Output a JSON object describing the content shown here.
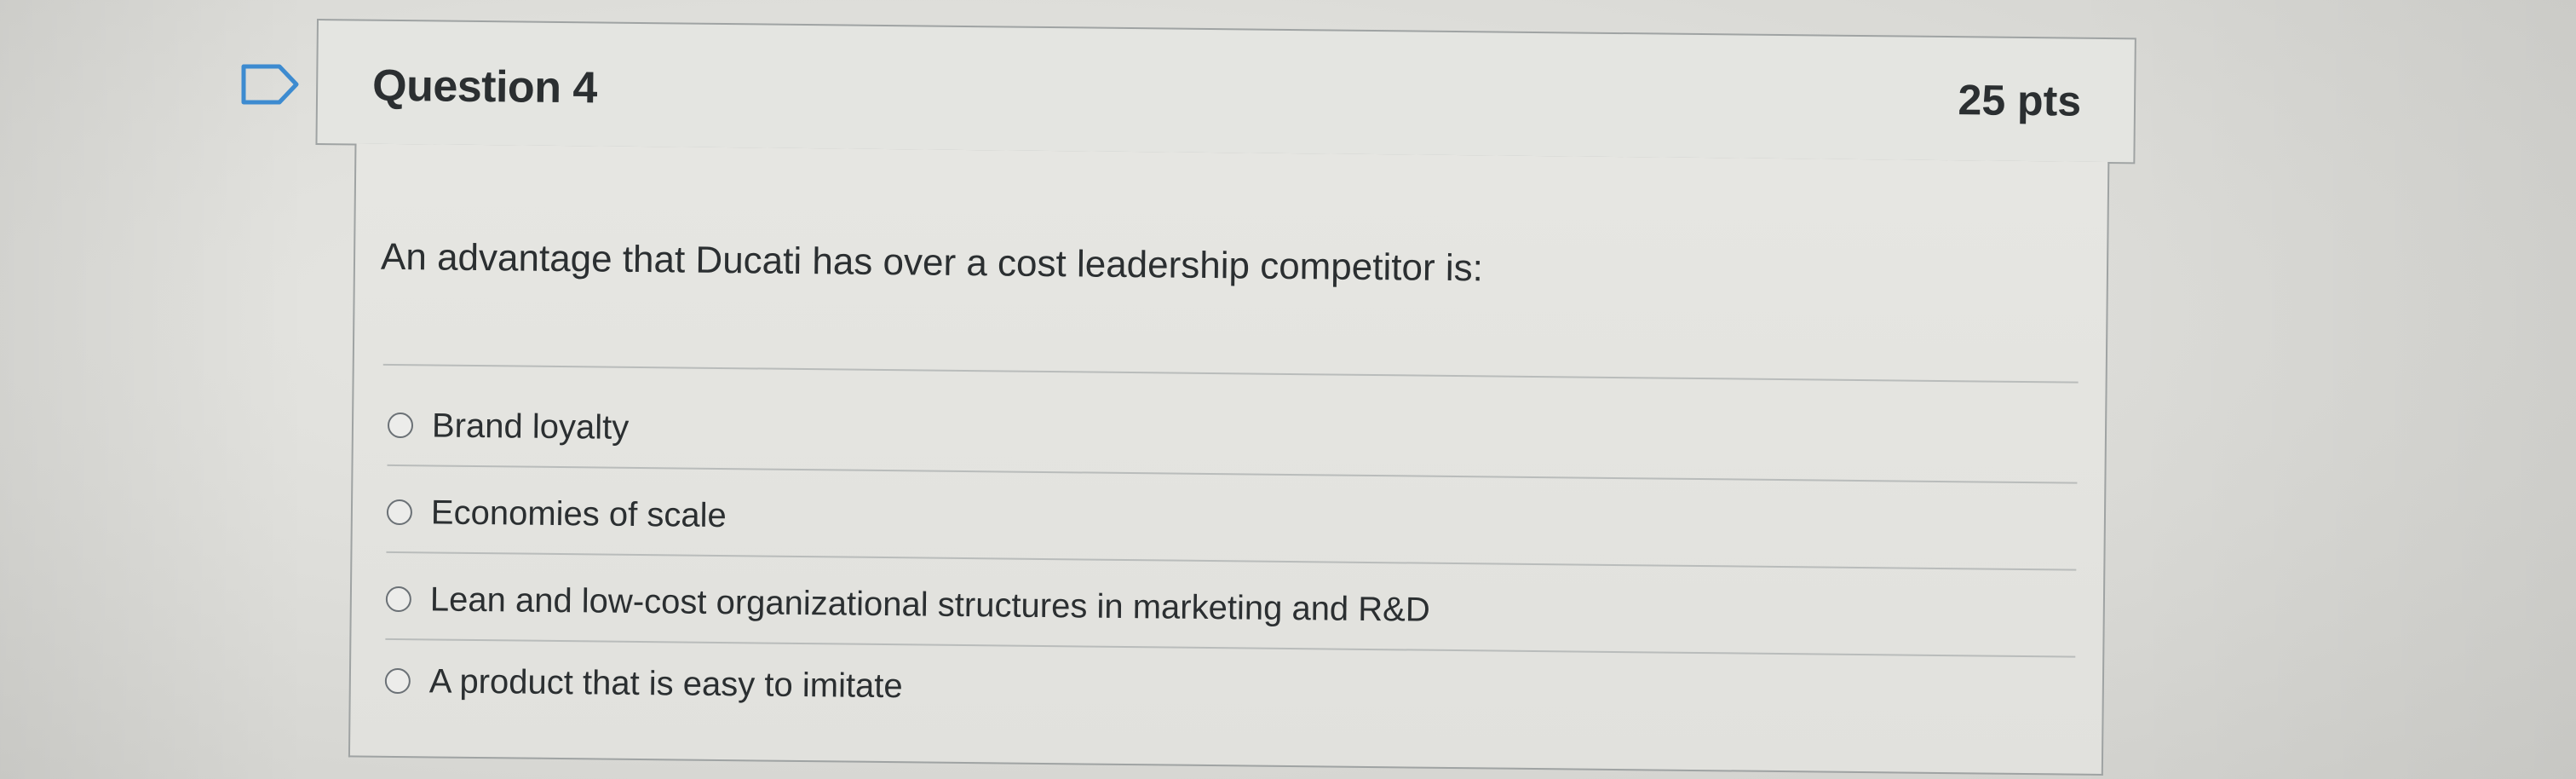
{
  "question": {
    "title": "Question 4",
    "points": "25 pts",
    "prompt": "An advantage that Ducati has over a cost leadership competitor is:",
    "flag_icon": "bookmark-flag-icon"
  },
  "answers": [
    {
      "label": "Brand loyalty",
      "selected": false
    },
    {
      "label": "Economies of scale",
      "selected": false
    },
    {
      "label": "Lean and low-cost organizational structures in marketing and R&D",
      "selected": false
    },
    {
      "label": "A product that is easy to imitate",
      "selected": false
    }
  ]
}
